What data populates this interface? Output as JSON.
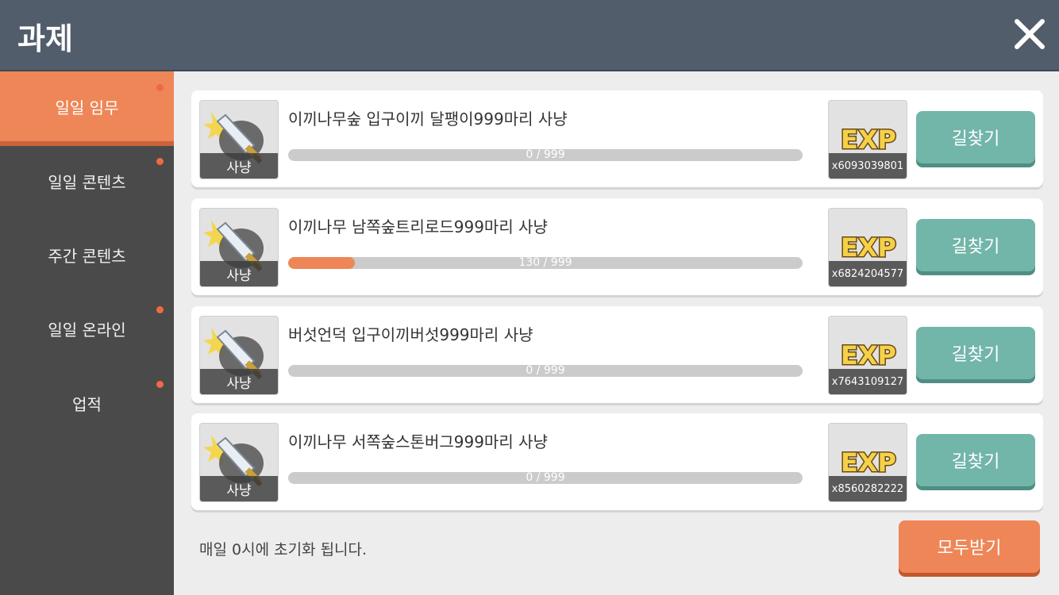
{
  "header": {
    "title": "과제"
  },
  "sidebar": {
    "items": [
      {
        "label": "일일 임무",
        "active": true,
        "has_dot": true
      },
      {
        "label": "일일 콘텐츠",
        "active": false,
        "has_dot": true
      },
      {
        "label": "주간 콘텐츠",
        "active": false,
        "has_dot": false
      },
      {
        "label": "일일 온라인",
        "active": false,
        "has_dot": true
      },
      {
        "label": "업적",
        "active": false,
        "has_dot": true
      }
    ]
  },
  "quests": [
    {
      "icon": "sword-icon",
      "icon_label": "사냥",
      "title": "이끼나무숲 입구이끼 달팽이999마리 사냥",
      "progress_text": "0 / 999",
      "progress_current": 0,
      "progress_max": 999,
      "reward_icon": "exp-icon",
      "reward_amount": "x6093039801",
      "button_label": "길찾기"
    },
    {
      "icon": "sword-icon",
      "icon_label": "사냥",
      "title": "이끼나무 남쪽숲트리로드999마리 사냥",
      "progress_text": "130 / 999",
      "progress_current": 130,
      "progress_max": 999,
      "reward_icon": "exp-icon",
      "reward_amount": "x6824204577",
      "button_label": "길찾기"
    },
    {
      "icon": "sword-icon",
      "icon_label": "사냥",
      "title": "버섯언덕 입구이끼버섯999마리 사냥",
      "progress_text": "0 / 999",
      "progress_current": 0,
      "progress_max": 999,
      "reward_icon": "exp-icon",
      "reward_amount": "x7643109127",
      "button_label": "길찾기"
    },
    {
      "icon": "sword-icon",
      "icon_label": "사냥",
      "title": "이끼나무 서쪽숲스톤버그999마리 사냥",
      "progress_text": "0 / 999",
      "progress_current": 0,
      "progress_max": 999,
      "reward_icon": "exp-icon",
      "reward_amount": "x8560282222",
      "button_label": "길찾기"
    }
  ],
  "footer": {
    "note": "매일 0시에 초기화 됩니다.",
    "claim_all_label": "모두받기"
  },
  "colors": {
    "header": "#525d6b",
    "sidebar": "#4a4a4a",
    "accent_orange": "#ee8657",
    "find_button": "#72b5a9",
    "dot": "#ee6a46"
  },
  "reward_icon_text": "EXP"
}
